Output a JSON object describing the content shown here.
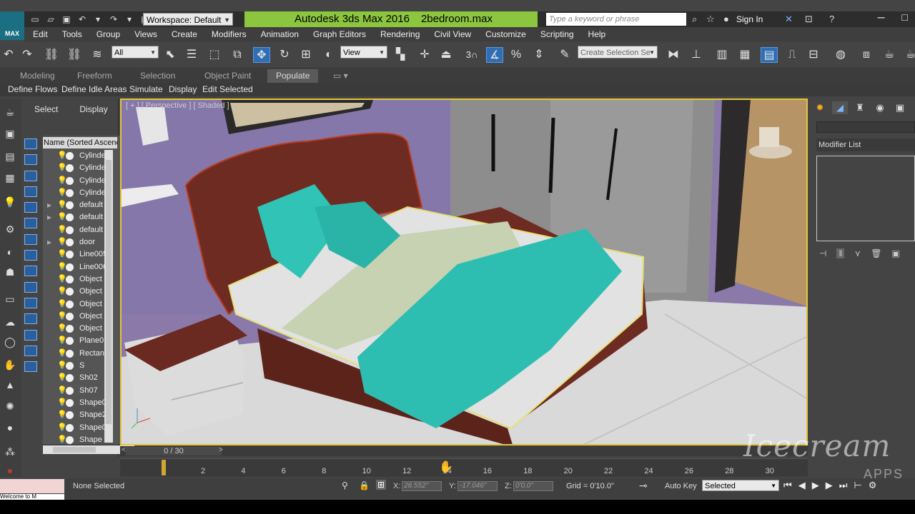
{
  "titlebar": {
    "workspace": "Workspace: Default",
    "app_title": "Autodesk 3ds Max 2016",
    "file_name": "2bedroom.max",
    "search_placeholder": "Type a keyword or phrase",
    "signin": "Sign In",
    "logo_text": "MAX"
  },
  "menu": [
    "Edit",
    "Tools",
    "Group",
    "Views",
    "Create",
    "Modifiers",
    "Animation",
    "Graph Editors",
    "Rendering",
    "Civil View",
    "Customize",
    "Scripting",
    "Help"
  ],
  "toolbar": {
    "selection_filter": "All",
    "ref_coord": "View",
    "snap_count": "3",
    "named_selection_placeholder": "Create Selection Se"
  },
  "ribbon": {
    "tabs": [
      "Modeling",
      "Freeform",
      "Selection",
      "Object Paint",
      "Populate"
    ],
    "active_tab": "Populate",
    "populate_items": [
      "Define Flows",
      "Define Idle Areas",
      "Simulate",
      "Display",
      "Edit Selected"
    ]
  },
  "explorer": {
    "tabs": [
      "Select",
      "Display"
    ],
    "column_header": "Name (Sorted Ascending)",
    "items": [
      {
        "name": "Cylinder",
        "expand": false
      },
      {
        "name": "Cylinder",
        "expand": false
      },
      {
        "name": "Cylinder",
        "expand": false
      },
      {
        "name": "Cylinder",
        "expand": false
      },
      {
        "name": "default",
        "expand": true
      },
      {
        "name": "default",
        "expand": true
      },
      {
        "name": "default",
        "expand": false
      },
      {
        "name": "door",
        "expand": true
      },
      {
        "name": "Line005",
        "expand": false
      },
      {
        "name": "Line006",
        "expand": false
      },
      {
        "name": "Object",
        "expand": false
      },
      {
        "name": "Object",
        "expand": false
      },
      {
        "name": "Object",
        "expand": false
      },
      {
        "name": "Object",
        "expand": false
      },
      {
        "name": "Object",
        "expand": false
      },
      {
        "name": "Plane0",
        "expand": false
      },
      {
        "name": "Rectan",
        "expand": false
      },
      {
        "name": "S",
        "expand": false
      },
      {
        "name": "Sh02",
        "expand": false
      },
      {
        "name": "Sh07",
        "expand": false
      },
      {
        "name": "Shape0",
        "expand": false
      },
      {
        "name": "Shape2",
        "expand": false
      },
      {
        "name": "Shape0",
        "expand": false
      },
      {
        "name": "Shape",
        "expand": false
      }
    ]
  },
  "viewport": {
    "label": "[ + ] [ Perspective ] [ Shaded ]"
  },
  "command_panel": {
    "modifier_list": "Modifier List"
  },
  "timeline": {
    "frame_display": "0 / 30",
    "ticks": [
      "2",
      "4",
      "6",
      "8",
      "10",
      "12",
      "14",
      "16",
      "18",
      "20",
      "22",
      "24",
      "26",
      "28",
      "30"
    ]
  },
  "status": {
    "selection": "None Selected",
    "x_label": "X:",
    "x_value": "28.552\"",
    "y_label": "Y:",
    "y_value": "-17.046\"",
    "z_label": "Z:",
    "z_value": "0'0.0\"",
    "grid": "Grid = 0'10.0\"",
    "auto_key": "Auto Key",
    "key_mode": "Selected",
    "listener_text": "Welcome to M"
  },
  "watermark": {
    "brand": "Icecream",
    "sub": "APPS"
  },
  "colors": {
    "title_strip": "#8cc63f",
    "viewport_border": "#e4c53a",
    "active_tool": "#2f6db5"
  }
}
